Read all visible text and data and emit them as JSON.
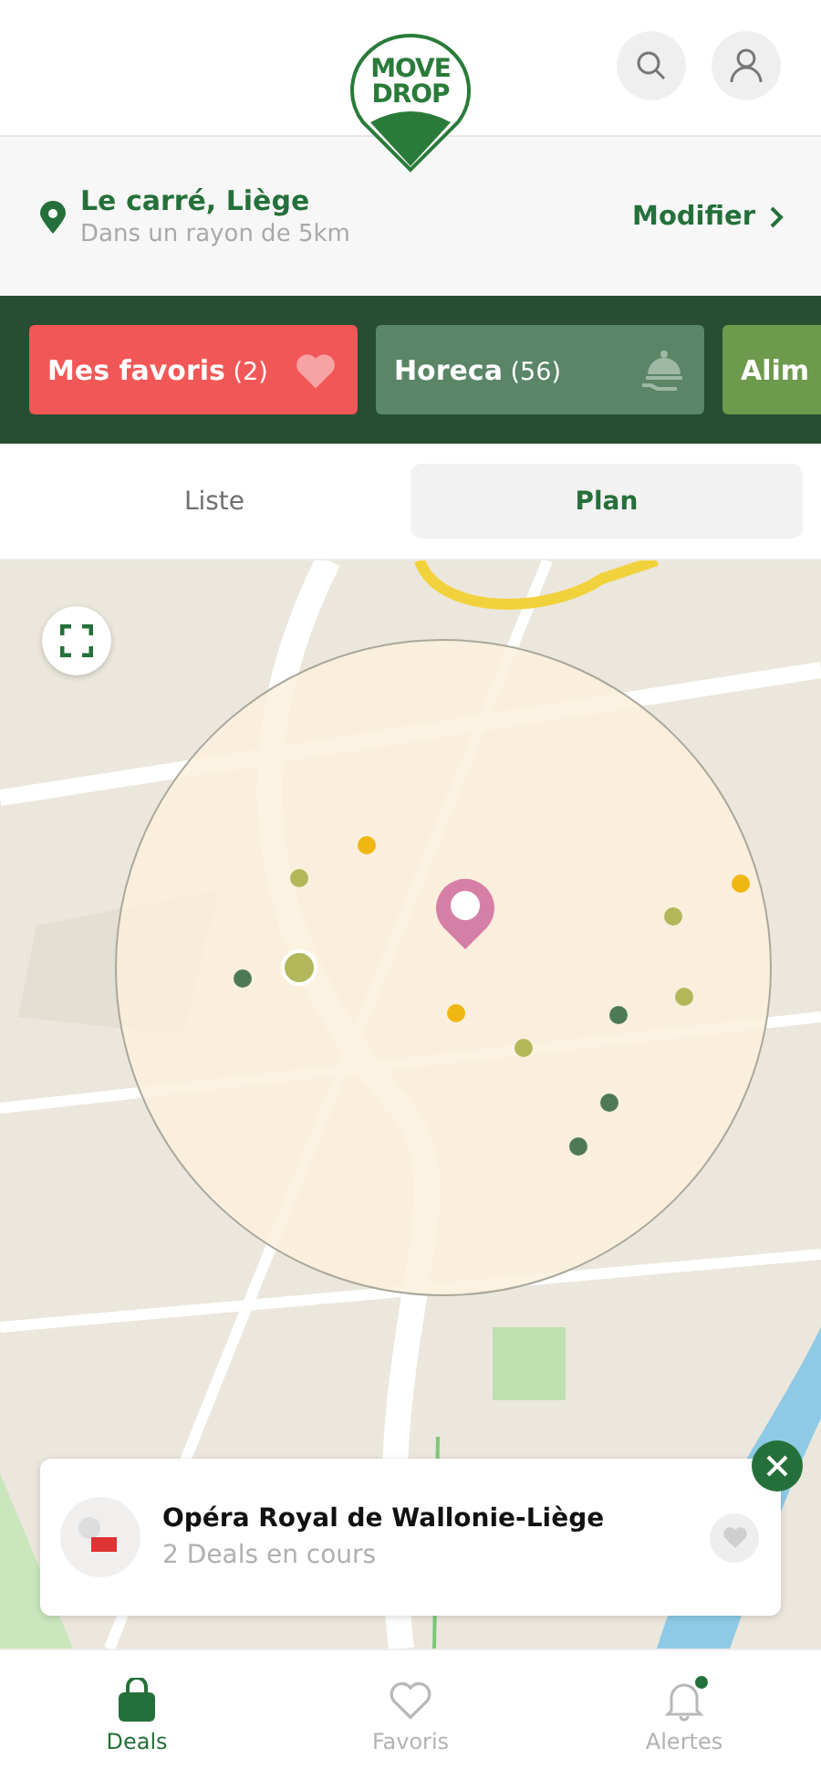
{
  "logo": {
    "line_1": "MOVE",
    "line_2": "DROP"
  },
  "location": {
    "place": "Le carré, Liège",
    "radius": "Dans un rayon de 5km",
    "action": "Modifier"
  },
  "categories": [
    {
      "kind": "favorites",
      "label": "Mes favoris",
      "count": "(2)",
      "color": "#f25757"
    },
    {
      "kind": "horeca",
      "label": "Horeca",
      "count": "(56)",
      "color": "#5a8566"
    },
    {
      "kind": "plain",
      "label": "Alim",
      "color": "#6d9a4c"
    }
  ],
  "view_tabs": [
    {
      "label": "Liste",
      "selected": false
    },
    {
      "label": "Plan",
      "selected": true
    }
  ],
  "map": {
    "pins": [
      {
        "color": "#b2b85a",
        "selected": false
      },
      {
        "color": "#f0b712",
        "selected": false
      },
      {
        "color": "#4d7a55",
        "selected": false
      },
      {
        "color": "#b2b85a",
        "selected": true
      },
      {
        "color": "#f0b712",
        "selected": false
      },
      {
        "color": "#b2b85a",
        "selected": false
      },
      {
        "color": "#4d7a55",
        "selected": false
      },
      {
        "color": "#b2b85a",
        "selected": false
      },
      {
        "color": "#b2b85a",
        "selected": false
      },
      {
        "color": "#f0b712",
        "selected": false
      },
      {
        "color": "#4d7a55",
        "selected": false
      },
      {
        "color": "#4d7a55",
        "selected": false
      }
    ]
  },
  "venue_card": {
    "name": "Opéra Royal de Wallonie-Liège",
    "deals": "2 Deals en cours",
    "favorite": false
  },
  "bottom_nav": [
    {
      "kind": "deals",
      "label": "Deals",
      "selected": true,
      "has_new": false
    },
    {
      "kind": "favorites",
      "label": "Favoris",
      "selected": false,
      "has_new": false
    },
    {
      "kind": "alerts",
      "label": "Alertes",
      "selected": false,
      "has_new": true
    }
  ]
}
